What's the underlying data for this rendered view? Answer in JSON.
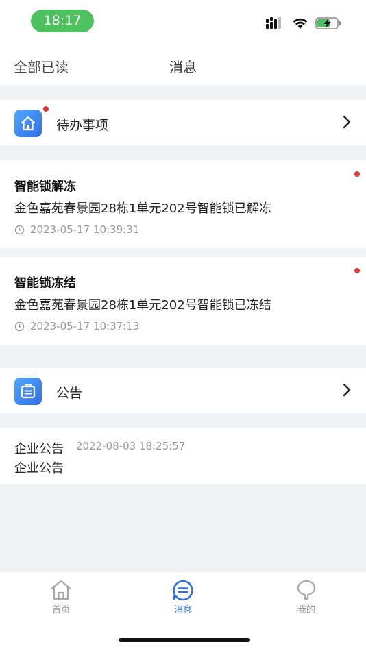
{
  "status_bar": {
    "time": "18:17"
  },
  "header": {
    "mark_all_read": "全部已读",
    "title": "消息"
  },
  "todo_entry": {
    "label": "待办事项"
  },
  "messages": [
    {
      "title": "智能锁解冻",
      "body": "金色嘉苑春景园28栋1单元202号智能锁已解冻",
      "time": "2023-05-17 10:39:31"
    },
    {
      "title": "智能锁冻结",
      "body": "金色嘉苑春景园28栋1单元202号智能锁已冻结",
      "time": "2023-05-17 10:37:13"
    }
  ],
  "notice_entry": {
    "label": "公告"
  },
  "notices": [
    {
      "title": "企业公告",
      "time": "2022-08-03 18:25:57",
      "body": "企业公告"
    }
  ],
  "tab_bar": {
    "tabs": [
      {
        "label": "首页",
        "icon": "home-icon"
      },
      {
        "label": "消息",
        "icon": "message-icon"
      },
      {
        "label": "我的",
        "icon": "profile-icon"
      }
    ],
    "active_color": "#2f6fe6",
    "inactive_color": "#9a9a9a"
  },
  "colors": {
    "accent": "#2f6fe6",
    "unread_dot": "#e53935",
    "time_pill": "#4cc15e"
  }
}
